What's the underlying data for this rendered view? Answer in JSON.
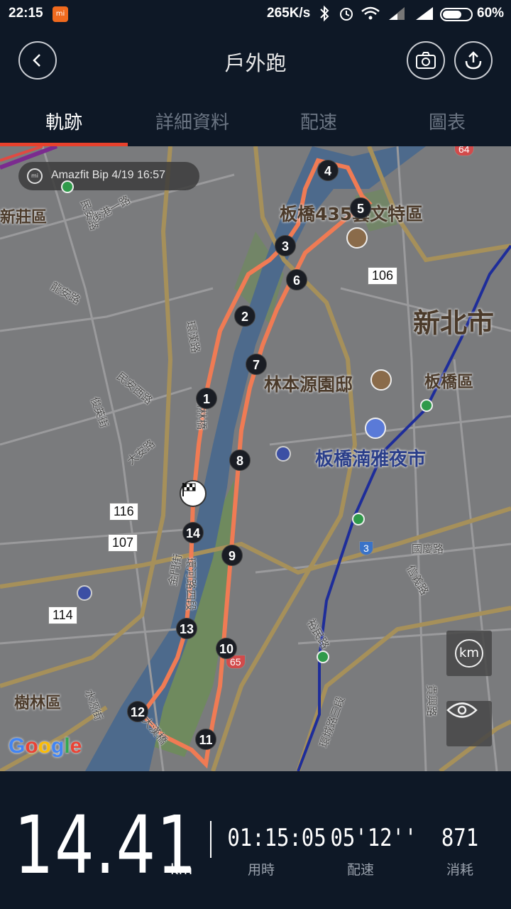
{
  "status_bar": {
    "time": "22:15",
    "network_speed": "265K/s",
    "battery": "60%"
  },
  "header": {
    "title": "戶外跑",
    "back_icon": "chevron-left-icon",
    "camera_icon": "camera-icon",
    "share_icon": "upload-icon"
  },
  "tabs": [
    {
      "label": "軌跡",
      "active": true
    },
    {
      "label": "詳細資料",
      "active": false
    },
    {
      "label": "配速",
      "active": false
    },
    {
      "label": "圖表",
      "active": false
    }
  ],
  "map": {
    "device_pill": "Amazfit Bip  4/19 16:57",
    "place_labels": {
      "xinzhuang": "新莊區",
      "banqiao435": "板橋435藝文特區",
      "new_taipei": "新北市",
      "banqiao_district": "板橋區",
      "lin_garden": "林本源園邸",
      "night_market": "板橋湳雅夜市",
      "shulin": "樹林區"
    },
    "road_labels": {
      "r1": "民安路",
      "r2": "後港一路",
      "r3": "龍安路",
      "r4": "民安西路",
      "r5": "俊英街",
      "r6": "大安路",
      "r7": "環漢路",
      "r8": "金門街",
      "r9": "環河路四段",
      "r10": "大漢橋",
      "r11": "水源街",
      "r12": "國慶路",
      "r13": "信義路",
      "r14": "裕民路",
      "r15": "環城路三段",
      "r16": "貴興路",
      "r17": "新林橋"
    },
    "shields": {
      "s64": "64",
      "s106": "106",
      "s116": "116",
      "s107": "107",
      "s114": "114",
      "s65": "65",
      "s3": "3"
    },
    "markers": [
      "1",
      "2",
      "3",
      "4",
      "5",
      "6",
      "7",
      "8",
      "9",
      "10",
      "11",
      "12",
      "13",
      "14"
    ],
    "km_button": "km",
    "google_logo": "Google"
  },
  "stats": {
    "distance": "14.41",
    "distance_unit": "km",
    "duration": "01:15:05",
    "duration_label": "用時",
    "pace": "05'12''",
    "pace_label": "配速",
    "calories": "871",
    "calories_label": "消耗"
  }
}
